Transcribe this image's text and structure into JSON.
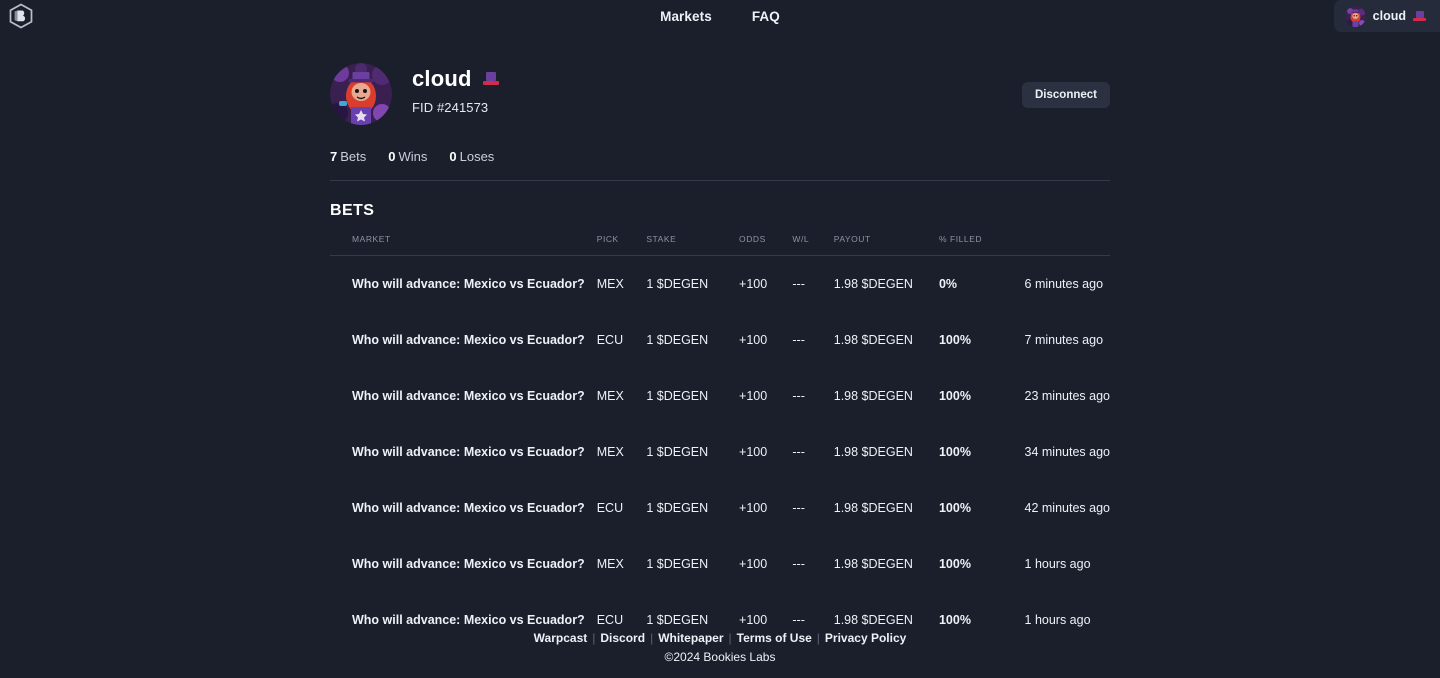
{
  "header": {
    "logo_icon": "bookies-hexagon-logo",
    "nav": [
      {
        "label": "Markets"
      },
      {
        "label": "FAQ"
      }
    ],
    "user_chip": {
      "name": "cloud",
      "badge_icon": "purple-top-hat-emoji",
      "avatar_icon": "user-avatar"
    }
  },
  "profile": {
    "avatar_icon": "user-avatar",
    "name": "cloud",
    "badge_icon": "purple-top-hat-emoji",
    "fid": "FID #241573",
    "disconnect_label": "Disconnect",
    "stats": [
      {
        "value": "7",
        "label": "Bets"
      },
      {
        "value": "0",
        "label": "Wins"
      },
      {
        "value": "0",
        "label": "Loses"
      }
    ]
  },
  "bets_section": {
    "title": "BETS",
    "columns": [
      "MARKET",
      "PICK",
      "STAKE",
      "ODDS",
      "W/L",
      "PAYOUT",
      "% FILLED"
    ],
    "rows": [
      {
        "market": "Who will advance: Mexico vs Ecuador?",
        "pick": "MEX",
        "stake": "1 $DEGEN",
        "odds": "+100",
        "wl": "---",
        "payout": "1.98 $DEGEN",
        "filled": "0%",
        "filled_state": "zero",
        "time": "6 minutes ago"
      },
      {
        "market": "Who will advance: Mexico vs Ecuador?",
        "pick": "ECU",
        "stake": "1 $DEGEN",
        "odds": "+100",
        "wl": "---",
        "payout": "1.98 $DEGEN",
        "filled": "100%",
        "filled_state": "full",
        "time": "7 minutes ago"
      },
      {
        "market": "Who will advance: Mexico vs Ecuador?",
        "pick": "MEX",
        "stake": "1 $DEGEN",
        "odds": "+100",
        "wl": "---",
        "payout": "1.98 $DEGEN",
        "filled": "100%",
        "filled_state": "full",
        "time": "23 minutes ago"
      },
      {
        "market": "Who will advance: Mexico vs Ecuador?",
        "pick": "MEX",
        "stake": "1 $DEGEN",
        "odds": "+100",
        "wl": "---",
        "payout": "1.98 $DEGEN",
        "filled": "100%",
        "filled_state": "full",
        "time": "34 minutes ago"
      },
      {
        "market": "Who will advance: Mexico vs Ecuador?",
        "pick": "ECU",
        "stake": "1 $DEGEN",
        "odds": "+100",
        "wl": "---",
        "payout": "1.98 $DEGEN",
        "filled": "100%",
        "filled_state": "full",
        "time": "42 minutes ago"
      },
      {
        "market": "Who will advance: Mexico vs Ecuador?",
        "pick": "MEX",
        "stake": "1 $DEGEN",
        "odds": "+100",
        "wl": "---",
        "payout": "1.98 $DEGEN",
        "filled": "100%",
        "filled_state": "full",
        "time": "1 hours ago"
      },
      {
        "market": "Who will advance: Mexico vs Ecuador?",
        "pick": "ECU",
        "stake": "1 $DEGEN",
        "odds": "+100",
        "wl": "---",
        "payout": "1.98 $DEGEN",
        "filled": "100%",
        "filled_state": "full",
        "time": "1 hours ago"
      }
    ]
  },
  "footer": {
    "links": [
      "Warpcast",
      "Discord",
      "Whitepaper",
      "Terms of Use",
      "Privacy Policy"
    ],
    "separator": "|",
    "copyright": "©2024 Bookies Labs"
  },
  "colors": {
    "background": "#1a1f2b",
    "chip_bg": "#252b3a",
    "text": "#eef1f6",
    "muted": "#8b93a4",
    "fill_full": "#14d14a",
    "fill_zero": "#e33c4e",
    "hat_purple": "#6b3fa0",
    "hat_red": "#d12d4a"
  }
}
